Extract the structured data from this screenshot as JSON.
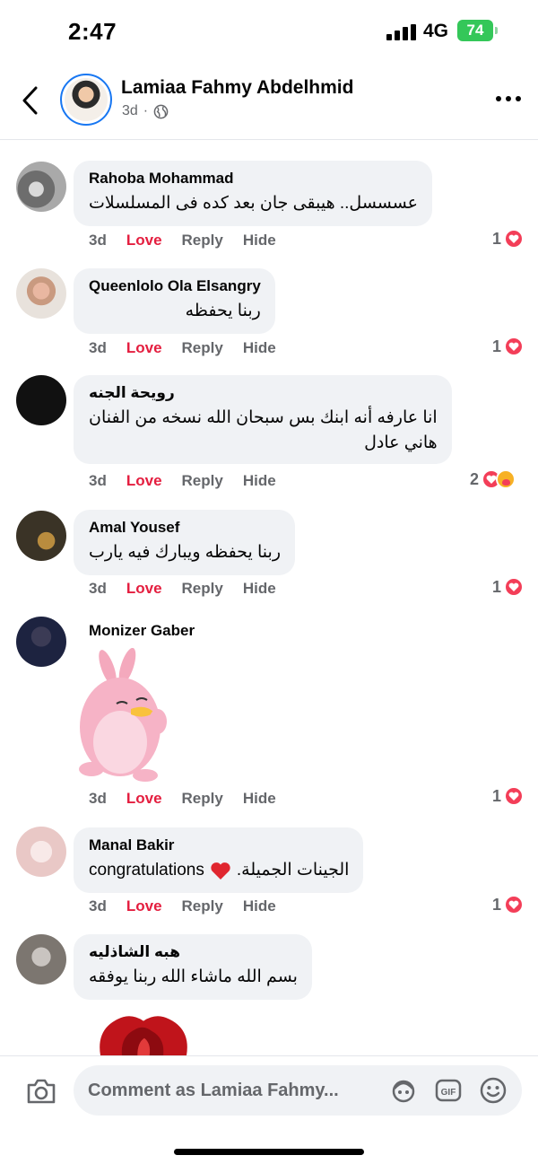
{
  "status_bar": {
    "time": "2:47",
    "network": "4G",
    "battery": "74"
  },
  "header": {
    "name": "Lamiaa Fahmy Abdelhmid",
    "time": "3d"
  },
  "actions": {
    "love": "Love",
    "reply": "Reply",
    "hide": "Hide"
  },
  "comments": [
    {
      "author": "Rahoba Mohammad",
      "text": "عسسسل.. هيبقى جان بعد كده فى المسلسلات",
      "time": "3d",
      "reactions": "1"
    },
    {
      "author": "Queenlolo Ola Elsangry",
      "text": "ربنا يحفظه",
      "time": "3d",
      "reactions": "1"
    },
    {
      "author": "رويحة الجنه",
      "text_line1": "انا عارفه أنه ابنك بس سبحان الله نسخه من الفنان",
      "text_line2": "هاني عادل",
      "time": "3d",
      "reactions": "2"
    },
    {
      "author": "Amal Yousef",
      "text": "ربنا يحفظه ويبارك فيه يارب",
      "time": "3d",
      "reactions": "1"
    },
    {
      "author": "Monizer Gaber",
      "time": "3d",
      "reactions": "1"
    },
    {
      "author": "Manal Bakir",
      "text_arabic": "الجينات الجميلة.",
      "text_latin": "congratulations",
      "time": "3d",
      "reactions": "1"
    },
    {
      "author": "هبه الشاذليه",
      "text": "بسم الله ماشاء الله ربنا يوفقه"
    }
  ],
  "composer": {
    "placeholder": "Comment as Lamiaa Fahmy..."
  },
  "colors": {
    "love": "#e41e3f",
    "accent": "#1877f2",
    "bubble": "#f0f2f5",
    "heart": "#f33e58"
  }
}
